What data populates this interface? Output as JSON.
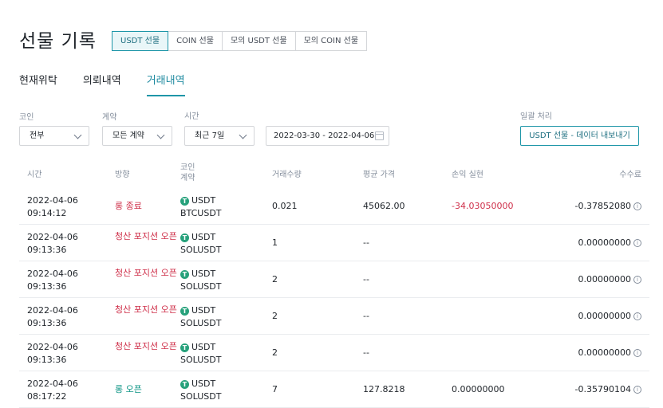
{
  "page_title": "선물 기록",
  "segments": [
    "USDT 선물",
    "COIN 선물",
    "모의 USDT 선물",
    "모의 COIN 선물"
  ],
  "tabs": [
    "현재위탁",
    "의뢰내역",
    "거래내역"
  ],
  "filters": {
    "coin_label": "코인",
    "coin_value": "전부",
    "contract_label": "계약",
    "contract_value": "모든 계약",
    "time_label": "시간",
    "time_value": "최근 7일",
    "date_range": "2022-03-30 - 2022-04-06",
    "bulk_label": "일괄 처리",
    "export_button": "USDT 선물 - 데이터 내보내기"
  },
  "table": {
    "headers": {
      "time": "시간",
      "direction": "방향",
      "coin_contract": [
        "코인",
        "계약"
      ],
      "quantity": "거래수량",
      "avg_price": "평균 가격",
      "pnl": "손익 실현",
      "fee": "수수료"
    },
    "rows": [
      {
        "date": "2022-04-06",
        "time": "09:14:12",
        "dir": "롱 종료",
        "dir_color": "red",
        "dir_lines": 1,
        "coin": "USDT",
        "symbol": "BTCUSDT",
        "qty": "0.021",
        "price": "45062.00",
        "pnl": "-34.03050000",
        "pnl_color": "red",
        "fee": "-0.37852080"
      },
      {
        "date": "2022-04-06",
        "time": "09:13:36",
        "dir": "청산 포지션 오픈",
        "dir_color": "red",
        "dir_lines": 2,
        "coin": "USDT",
        "symbol": "SOLUSDT",
        "qty": "1",
        "price": "--",
        "pnl": "",
        "pnl_color": "",
        "fee": "0.00000000"
      },
      {
        "date": "2022-04-06",
        "time": "09:13:36",
        "dir": "청산 포지션 오픈",
        "dir_color": "red",
        "dir_lines": 2,
        "coin": "USDT",
        "symbol": "SOLUSDT",
        "qty": "2",
        "price": "--",
        "pnl": "",
        "pnl_color": "",
        "fee": "0.00000000"
      },
      {
        "date": "2022-04-06",
        "time": "09:13:36",
        "dir": "청산 포지션 오픈",
        "dir_color": "red",
        "dir_lines": 2,
        "coin": "USDT",
        "symbol": "SOLUSDT",
        "qty": "2",
        "price": "--",
        "pnl": "",
        "pnl_color": "",
        "fee": "0.00000000"
      },
      {
        "date": "2022-04-06",
        "time": "09:13:36",
        "dir": "청산 포지션 오픈",
        "dir_color": "red",
        "dir_lines": 2,
        "coin": "USDT",
        "symbol": "SOLUSDT",
        "qty": "2",
        "price": "--",
        "pnl": "",
        "pnl_color": "",
        "fee": "0.00000000"
      },
      {
        "date": "2022-04-06",
        "time": "08:17:22",
        "dir": "롱 오픈",
        "dir_color": "green",
        "dir_lines": 1,
        "coin": "USDT",
        "symbol": "SOLUSDT",
        "qty": "7",
        "price": "127.8218",
        "pnl": "0.00000000",
        "pnl_color": "",
        "fee": "-0.35790104"
      }
    ]
  },
  "colors": {
    "accent": "#1e96a8",
    "negative": "#cf304a",
    "positive": "#0e9585",
    "tether": "#26a17b"
  },
  "icons": {
    "tether": "tether-icon",
    "info": "info-icon",
    "calendar": "calendar-icon",
    "chevron": "chevron-down-icon"
  }
}
